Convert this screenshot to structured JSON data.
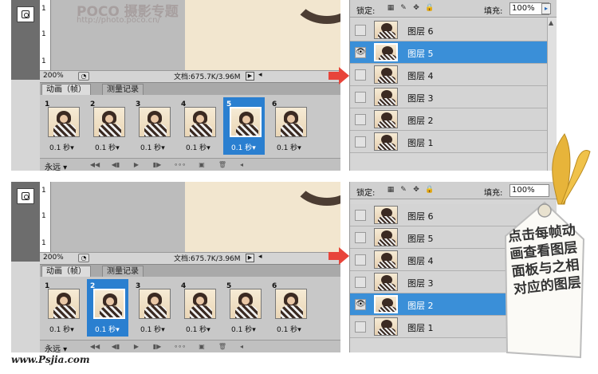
{
  "watermark_logo": "POCO 摄影专题",
  "watermark_url": "http://photo.poco.cn/",
  "site_watermark": "www.Psjia.com",
  "zoom": "200%",
  "doc_info": "文档:675.7K/3.96M",
  "tabs": {
    "animation": "动画（帧）",
    "measure": "测量记录"
  },
  "loop": "永远",
  "frame_time": "0.1 秒",
  "frame_numbers": [
    "1",
    "2",
    "3",
    "4",
    "5",
    "6"
  ],
  "lock_label": "锁定:",
  "fill_label": "填充:",
  "fill_value": "100%",
  "layers": [
    "图层 6",
    "图层 5",
    "图层 4",
    "图层 3",
    "图层 2",
    "图层 1"
  ],
  "top_panel": {
    "selected_frame": 5,
    "active_layer": "图层 5"
  },
  "bottom_panel": {
    "selected_frame": 2,
    "active_layer": "图层 2"
  },
  "tag_text": "点击每帧动画查看图层面板与之相对应的图层",
  "colors": {
    "selection": "#2a7fd0",
    "active_layer": "#3a8fd8",
    "arrow": "#e8443a",
    "ribbon": "#e7b43a"
  }
}
